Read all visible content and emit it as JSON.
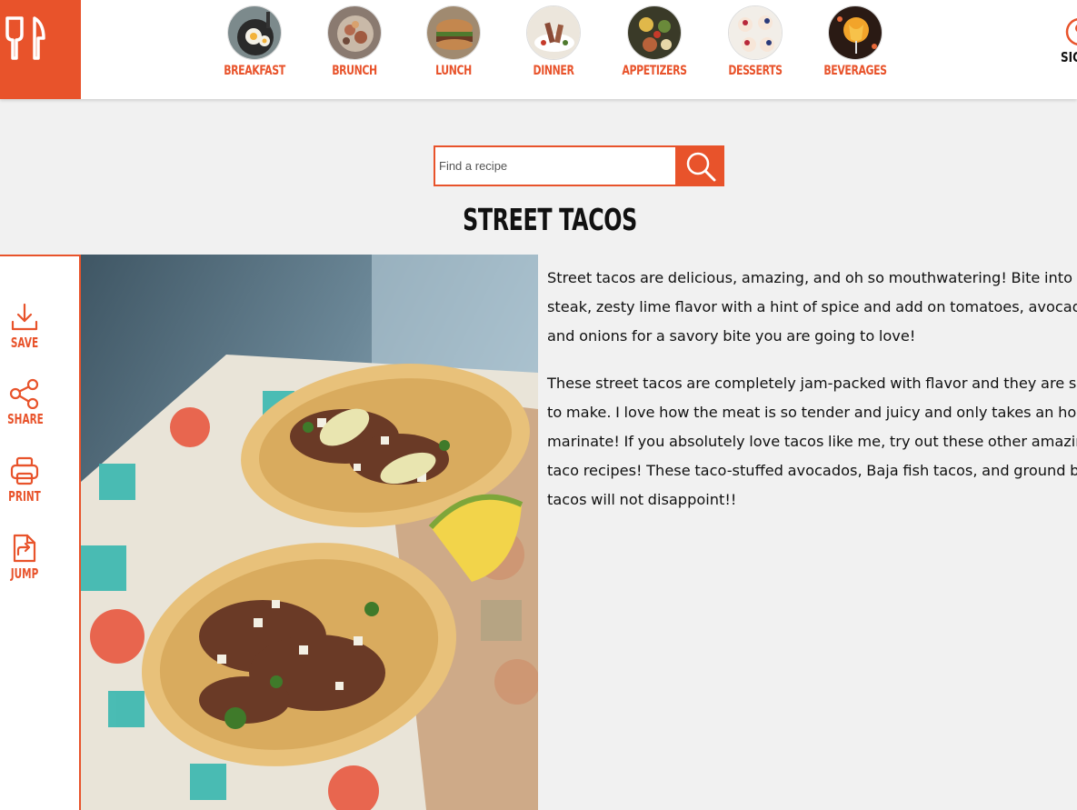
{
  "nav": {
    "items": [
      {
        "label": "BREAKFAST",
        "icon": "breakfast-thumb"
      },
      {
        "label": "BRUNCH",
        "icon": "brunch-thumb"
      },
      {
        "label": "LUNCH",
        "icon": "lunch-thumb"
      },
      {
        "label": "DINNER",
        "icon": "dinner-thumb"
      },
      {
        "label": "APPETIZERS",
        "icon": "appetizers-thumb"
      },
      {
        "label": "DESSERTS",
        "icon": "desserts-thumb"
      },
      {
        "label": "BEVERAGES",
        "icon": "beverages-thumb"
      }
    ],
    "signin_label": "SIG"
  },
  "search": {
    "placeholder": "Find a recipe",
    "value": ""
  },
  "recipe": {
    "title": "STREET TACOS",
    "paragraphs": [
      "Street tacos are delicious, amazing, and oh so mouthwatering! Bite into tender steak, zesty lime flavor with a hint of spice and add on tomatoes, avocados and onions for a savory bite you are going to love!",
      "These street tacos are completely jam-packed with flavor and they are so easy to make. I love how the meat is so tender and juicy and only takes an hour to marinate! If you absolutely love tacos like me, try out these other amazing taco recipes! These taco-stuffed avocados, Baja fish tacos, and ground beef tacos will not disappoint!!"
    ]
  },
  "sidebar": {
    "items": [
      {
        "label": "SAVE",
        "icon": "download-icon"
      },
      {
        "label": "SHARE",
        "icon": "share-icon"
      },
      {
        "label": "PRINT",
        "icon": "print-icon"
      },
      {
        "label": "JUMP",
        "icon": "jump-icon"
      }
    ]
  },
  "colors": {
    "accent": "#e8532b",
    "background": "#f1f1f1",
    "text": "#111111"
  }
}
